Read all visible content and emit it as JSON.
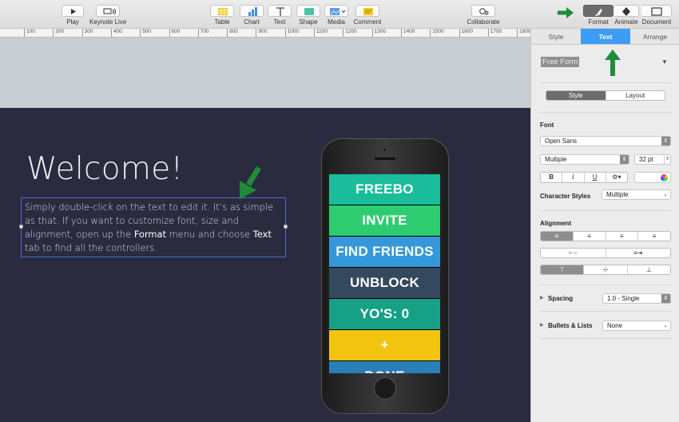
{
  "toolbar": {
    "play": "Play",
    "keynote_live": "Keynote Live",
    "table": "Table",
    "chart": "Chart",
    "text": "Text",
    "shape": "Shape",
    "media": "Media",
    "comment": "Comment",
    "collaborate": "Collaborate",
    "format": "Format",
    "animate": "Animate",
    "document": "Document"
  },
  "ruler": [
    "100",
    "200",
    "300",
    "400",
    "500",
    "600",
    "700",
    "800",
    "900",
    "1000",
    "1100",
    "1200",
    "1300",
    "1400",
    "1500",
    "1600",
    "1700",
    "1800"
  ],
  "slide": {
    "title": "Welcome!",
    "body_1": "Simply double-click on the text to edit it. It’s as simple as that. If you want to customize font, size and alignment, open up the ",
    "body_bold_1": "Format",
    "body_2": " menu and choose ",
    "body_bold_2": "Text",
    "body_3": " tab to find all the controllers."
  },
  "phone": {
    "buttons": [
      {
        "label": "FREEBO",
        "color": "#1bbc9b"
      },
      {
        "label": "INVITE",
        "color": "#2ecc71"
      },
      {
        "label": "FIND FRIENDS",
        "color": "#3498db"
      },
      {
        "label": "UNBLOCK",
        "color": "#34495e"
      },
      {
        "label": "YO'S: 0",
        "color": "#16a085"
      },
      {
        "label": "+",
        "color": "#f1c40f"
      },
      {
        "label": "DONE",
        "color": "#2980b9"
      }
    ]
  },
  "inspector": {
    "tabs": [
      "Style",
      "Text",
      "Arrange"
    ],
    "active_tab": "Text",
    "paragraph_style": "Free Form",
    "subtabs": [
      "Style",
      "Layout"
    ],
    "font_label": "Font",
    "font_family": "Open Sans",
    "font_weight": "Multiple",
    "font_size": "32 pt",
    "bold": "B",
    "italic": "I",
    "underline": "U",
    "character_styles_label": "Character Styles",
    "character_styles_value": "Multiple",
    "alignment_label": "Alignment",
    "spacing_label": "Spacing",
    "spacing_value": "1.0 - Single",
    "bullets_label": "Bullets & Lists",
    "bullets_value": "None"
  },
  "colors": {
    "accent": "#3d9cf5",
    "slide_bg": "#2b2b3f",
    "annotation_arrow": "#1e8c3a"
  }
}
